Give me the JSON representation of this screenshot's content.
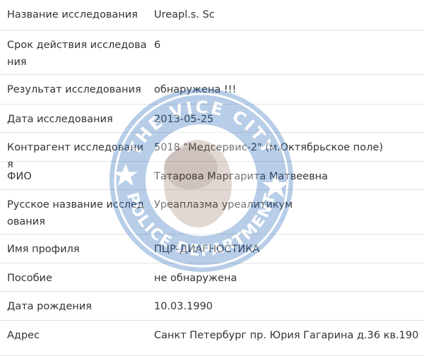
{
  "rows": [
    {
      "label": "Название исследования",
      "value": "Ureapl.s. Sc"
    },
    {
      "label": "Срок действия исследования",
      "value": "6"
    },
    {
      "label": "Результат исследования",
      "value": "обнаружена !!!"
    },
    {
      "label": "Дата исследования",
      "value": "2013-05-25"
    },
    {
      "label": "Контрагент исследования",
      "value": "5018 \"Медсервис-2\" (м.Октябрьское поле)"
    },
    {
      "label": "ФИО",
      "value": "Татарова Маргарита Матвеевна"
    },
    {
      "label": "Русское название исследования",
      "value": "Уреаплазма уреалитикум"
    },
    {
      "label": "Имя профиля",
      "value": "ПЦР-ДИАГНОСТИКА"
    },
    {
      "label": "Пособие",
      "value": "не обнаружена"
    },
    {
      "label": "Дата рождения",
      "value": "10.03.1990"
    },
    {
      "label": "Адрес",
      "value": "Санкт Петербург пр. Юрия Гагарина д.36 кв.190"
    }
  ],
  "watermark": {
    "text_top": "THE VICE CITY",
    "text_bottom": "POLICE DEPARTMENT",
    "color": "#1f5fa8"
  }
}
